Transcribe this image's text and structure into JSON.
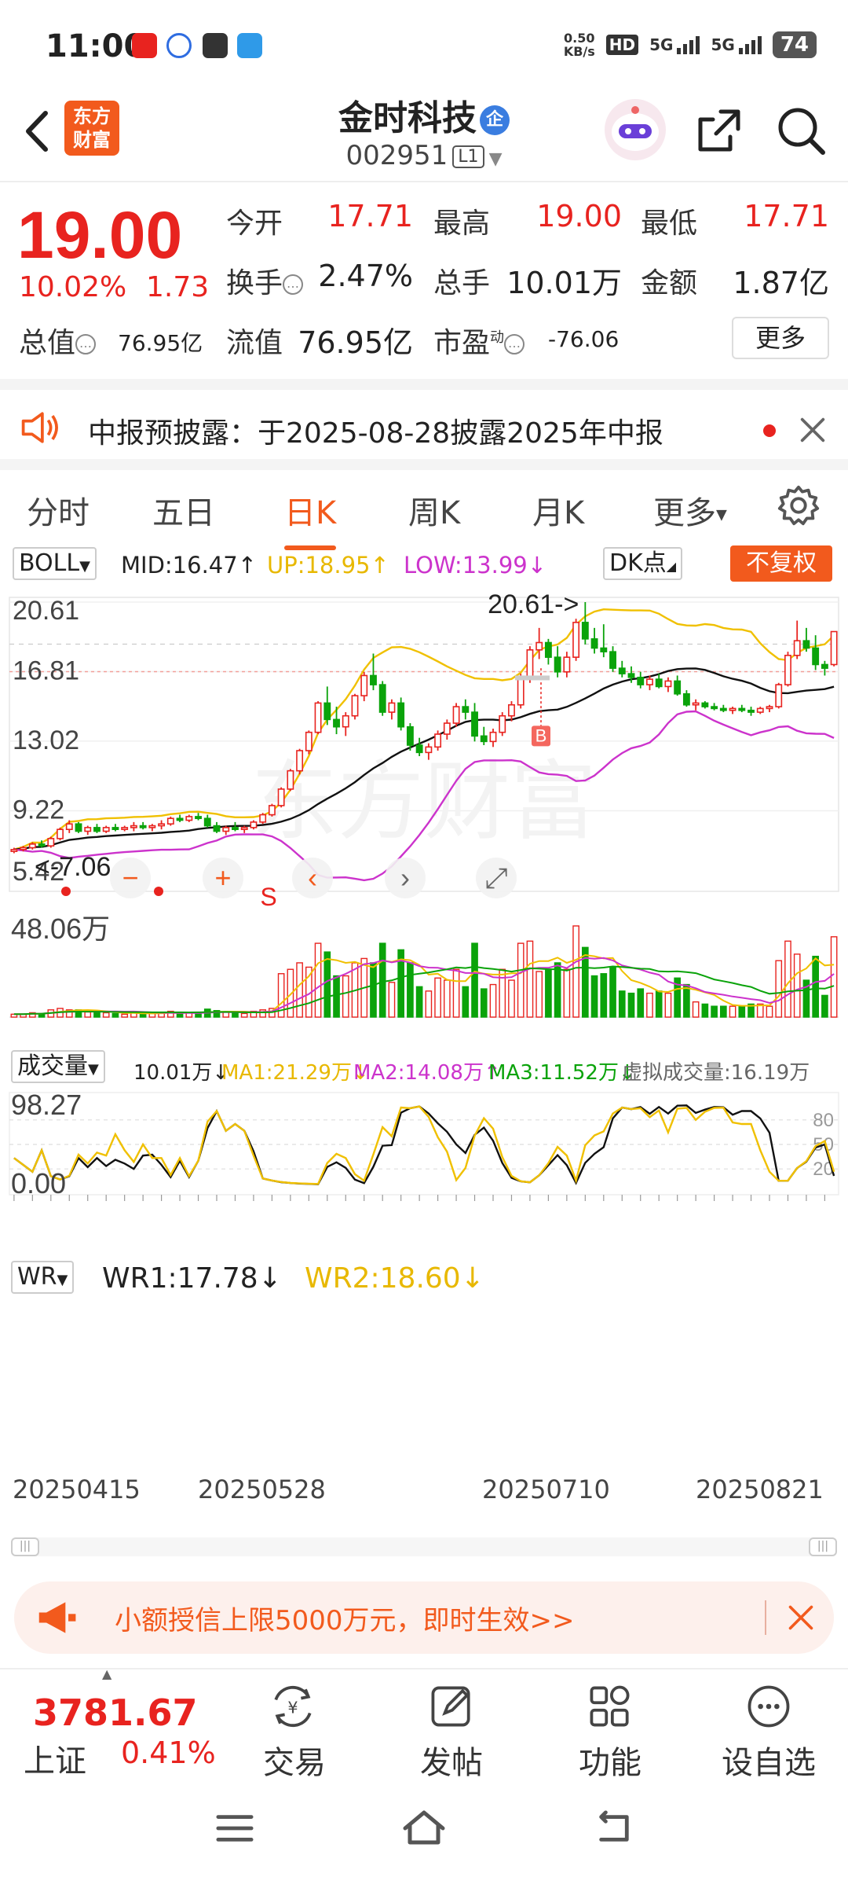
{
  "status_bar": {
    "time": "11:00",
    "net_speed_value": "0.50",
    "net_speed_unit": "KB/s",
    "hd": "HD",
    "signal1": "5G",
    "signal2": "5G",
    "battery": "74"
  },
  "header": {
    "logo_line1": "东方",
    "logo_line2": "财富",
    "stock_name": "金时科技",
    "enterprise_badge": "企",
    "stock_code": "002951",
    "level": "L1"
  },
  "quote": {
    "price": "19.00",
    "change_pct": "10.02%",
    "change_amt": "1.73",
    "open_label": "今开",
    "open": "17.71",
    "high_label": "最高",
    "high": "19.00",
    "low_label": "最低",
    "low": "17.71",
    "turnover_label": "换手",
    "turnover": "2.47%",
    "volume_label": "总手",
    "volume": "10.01万",
    "amount_label": "金额",
    "amount": "1.87亿",
    "total_mv_label": "总值",
    "total_mv": "76.95亿",
    "float_mv_label": "流值",
    "float_mv": "76.95亿",
    "pe_label": "市盈",
    "pe_sup": "动",
    "pe": "-76.06",
    "more": "更多"
  },
  "notice": {
    "text": "中报预披露：于2025-08-28披露2025年中报"
  },
  "tabs": [
    "分时",
    "五日",
    "日K",
    "周K",
    "月K",
    "更多"
  ],
  "active_tab": "日K",
  "boll": {
    "indicator": "BOLL",
    "mid": "MID:16.47↑",
    "up": "UP:18.95↑",
    "low": "LOW:13.99↓",
    "dk": "DK点",
    "adjust": "不复权",
    "price_labels": [
      "20.61",
      "16.81",
      "13.02",
      "9.22",
      "5.42"
    ],
    "max_annot": "20.61->",
    "min_annot": "<-7.06",
    "signal_s": "S",
    "signal_b": "B"
  },
  "volume": {
    "indicator": "成交量",
    "value": "10.01万↓",
    "ma1": "MA1:21.29万↓",
    "ma2": "MA2:14.08万↑",
    "ma3": "MA3:11.52万↓",
    "virtual": "虚拟成交量:16.19万",
    "max_label": "48.06万"
  },
  "wr": {
    "indicator": "WR",
    "wr1": "WR1:17.78↓",
    "wr2": "WR2:18.60↓",
    "max_label": "98.27",
    "min_label": "0.00",
    "levels": [
      "80",
      "50",
      "20"
    ]
  },
  "dates": [
    "20250415",
    "20250528",
    "20250710",
    "20250821"
  ],
  "watermark": "东方财富",
  "promo": {
    "text": "小额授信上限5000万元，即时生效>>"
  },
  "bottom": {
    "index_value": "3781.67",
    "index_name": "上证",
    "index_pct": "0.41%",
    "nav": [
      "交易",
      "发帖",
      "功能",
      "设自选"
    ]
  },
  "colors": {
    "up": "#e8231f",
    "down": "#0aa30a",
    "brand": "#f25a1d",
    "boll_up": "#f0c000",
    "boll_low": "#cc33cc",
    "boll_mid": "#111111"
  },
  "chart_data": {
    "type": "candlestick",
    "x_range": [
      "20250415",
      "20250827"
    ],
    "y_range": [
      5.42,
      20.61
    ],
    "candles": [
      [
        7.0,
        7.2,
        6.9,
        7.1
      ],
      [
        7.1,
        7.3,
        7.0,
        7.2
      ],
      [
        7.2,
        7.5,
        7.1,
        7.4
      ],
      [
        7.4,
        7.6,
        7.2,
        7.3
      ],
      [
        7.3,
        7.8,
        7.2,
        7.7
      ],
      [
        7.7,
        8.3,
        7.6,
        8.2
      ],
      [
        8.2,
        8.7,
        8.0,
        8.5
      ],
      [
        8.5,
        8.6,
        8.0,
        8.1
      ],
      [
        8.1,
        8.4,
        7.9,
        8.3
      ],
      [
        8.3,
        8.5,
        8.0,
        8.1
      ],
      [
        8.1,
        8.4,
        8.0,
        8.3
      ],
      [
        8.3,
        8.5,
        8.1,
        8.2
      ],
      [
        8.2,
        8.4,
        8.1,
        8.3
      ],
      [
        8.3,
        8.6,
        8.1,
        8.4
      ],
      [
        8.4,
        8.6,
        8.2,
        8.3
      ],
      [
        8.3,
        8.5,
        8.1,
        8.4
      ],
      [
        8.4,
        8.7,
        8.2,
        8.5
      ],
      [
        8.5,
        8.9,
        8.4,
        8.8
      ],
      [
        8.8,
        9.0,
        8.6,
        8.7
      ],
      [
        8.7,
        9.0,
        8.6,
        8.9
      ],
      [
        8.9,
        9.1,
        8.7,
        8.8
      ],
      [
        8.8,
        9.0,
        8.3,
        8.4
      ],
      [
        8.4,
        8.6,
        8.0,
        8.1
      ],
      [
        8.1,
        8.4,
        7.9,
        8.3
      ],
      [
        8.3,
        8.6,
        8.1,
        8.2
      ],
      [
        8.2,
        8.4,
        8.0,
        8.3
      ],
      [
        8.3,
        8.7,
        8.2,
        8.6
      ],
      [
        8.6,
        9.1,
        8.5,
        9.0
      ],
      [
        9.0,
        9.6,
        8.9,
        9.5
      ],
      [
        9.5,
        10.5,
        9.4,
        10.4
      ],
      [
        10.4,
        11.5,
        10.3,
        11.4
      ],
      [
        11.4,
        12.6,
        11.2,
        12.5
      ],
      [
        12.5,
        13.6,
        12.3,
        13.5
      ],
      [
        13.5,
        15.2,
        13.4,
        15.1
      ],
      [
        15.1,
        16.0,
        13.9,
        14.2
      ],
      [
        14.2,
        14.9,
        13.4,
        13.8
      ],
      [
        13.8,
        14.6,
        13.3,
        14.4
      ],
      [
        14.4,
        15.6,
        14.2,
        15.5
      ],
      [
        15.5,
        16.8,
        15.2,
        16.6
      ],
      [
        16.6,
        17.8,
        15.8,
        16.1
      ],
      [
        16.1,
        16.3,
        14.4,
        14.6
      ],
      [
        14.6,
        15.3,
        14.2,
        15.1
      ],
      [
        15.1,
        15.4,
        13.6,
        13.8
      ],
      [
        13.8,
        14.0,
        12.5,
        12.8
      ],
      [
        12.8,
        13.2,
        12.2,
        12.4
      ],
      [
        12.4,
        12.9,
        12.0,
        12.7
      ],
      [
        12.7,
        13.6,
        12.5,
        13.4
      ],
      [
        13.4,
        14.2,
        13.1,
        14.0
      ],
      [
        14.0,
        15.1,
        13.8,
        14.9
      ],
      [
        14.9,
        15.3,
        14.2,
        14.6
      ],
      [
        14.6,
        15.1,
        13.0,
        13.3
      ],
      [
        13.3,
        13.8,
        12.8,
        13.0
      ],
      [
        13.0,
        13.7,
        12.7,
        13.5
      ],
      [
        13.5,
        14.6,
        13.3,
        14.4
      ],
      [
        14.4,
        15.2,
        14.1,
        15.0
      ],
      [
        15.0,
        16.7,
        14.8,
        16.5
      ],
      [
        16.5,
        18.2,
        16.2,
        18.0
      ],
      [
        18.0,
        19.2,
        17.5,
        18.4
      ],
      [
        18.4,
        18.6,
        17.2,
        17.6
      ],
      [
        17.6,
        18.2,
        16.5,
        16.8
      ],
      [
        16.8,
        17.9,
        16.5,
        17.6
      ],
      [
        17.6,
        19.7,
        17.4,
        19.5
      ],
      [
        19.5,
        20.61,
        18.3,
        18.6
      ],
      [
        18.6,
        19.2,
        17.8,
        18.1
      ],
      [
        18.1,
        19.4,
        17.6,
        17.9
      ],
      [
        17.9,
        18.2,
        16.8,
        17.0
      ],
      [
        17.0,
        17.4,
        16.5,
        16.7
      ],
      [
        16.7,
        17.1,
        16.2,
        16.5
      ],
      [
        16.5,
        16.8,
        15.9,
        16.1
      ],
      [
        16.1,
        16.6,
        15.8,
        16.4
      ],
      [
        16.4,
        16.7,
        15.9,
        16.0
      ],
      [
        16.0,
        16.5,
        15.7,
        16.3
      ],
      [
        16.3,
        16.6,
        15.5,
        15.6
      ],
      [
        15.6,
        15.8,
        14.9,
        15.0
      ],
      [
        15.0,
        15.3,
        14.7,
        15.1
      ],
      [
        15.1,
        15.2,
        14.8,
        14.9
      ],
      [
        14.9,
        15.1,
        14.7,
        14.8
      ],
      [
        14.8,
        15.0,
        14.6,
        14.7
      ],
      [
        14.7,
        14.9,
        14.5,
        14.8
      ],
      [
        14.8,
        15.0,
        14.6,
        14.7
      ],
      [
        14.7,
        14.9,
        14.4,
        14.6
      ],
      [
        14.6,
        14.9,
        14.5,
        14.8
      ],
      [
        14.8,
        15.0,
        14.6,
        14.9
      ],
      [
        14.9,
        16.2,
        14.8,
        16.1
      ],
      [
        16.1,
        17.9,
        16.0,
        17.7
      ],
      [
        17.7,
        19.6,
        17.5,
        18.5
      ],
      [
        18.5,
        19.2,
        17.9,
        18.1
      ],
      [
        18.1,
        18.8,
        16.9,
        17.2
      ],
      [
        17.2,
        17.4,
        16.6,
        17.0
      ],
      [
        17.2,
        19.0,
        17.1,
        19.0
      ]
    ]
  }
}
